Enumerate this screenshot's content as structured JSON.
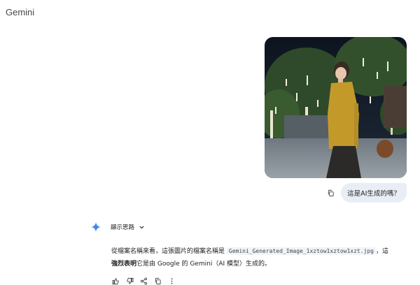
{
  "app": {
    "title": "Gemini"
  },
  "user_message": {
    "text": "這是AI生成的嗎？",
    "image_icon": "photo-attachment"
  },
  "model": {
    "thinking_label": "顯示思路",
    "response": {
      "part1": "從檔案名稱來看，這張圖片的檔案名稱是 ",
      "filename": "Gemini_Generated_Image_1xztow1xztow1xzt.jpg",
      "part2": "，這",
      "bold": "強烈表明",
      "part3": "它是由 Google 的 Gemini（AI 模型）生成的。"
    }
  },
  "icons": {
    "copy": "copy-icon",
    "star": "gemini-sparkle-icon",
    "chevron": "chevron-down-icon",
    "thumbs_up": "thumbs-up-icon",
    "thumbs_down": "thumbs-down-icon",
    "share": "share-icon",
    "copy_response": "copy-icon",
    "more": "more-vert-icon"
  },
  "colors": {
    "accent": "#4285f4",
    "bubble": "#e9eef6",
    "text": "#1f1f1f"
  }
}
